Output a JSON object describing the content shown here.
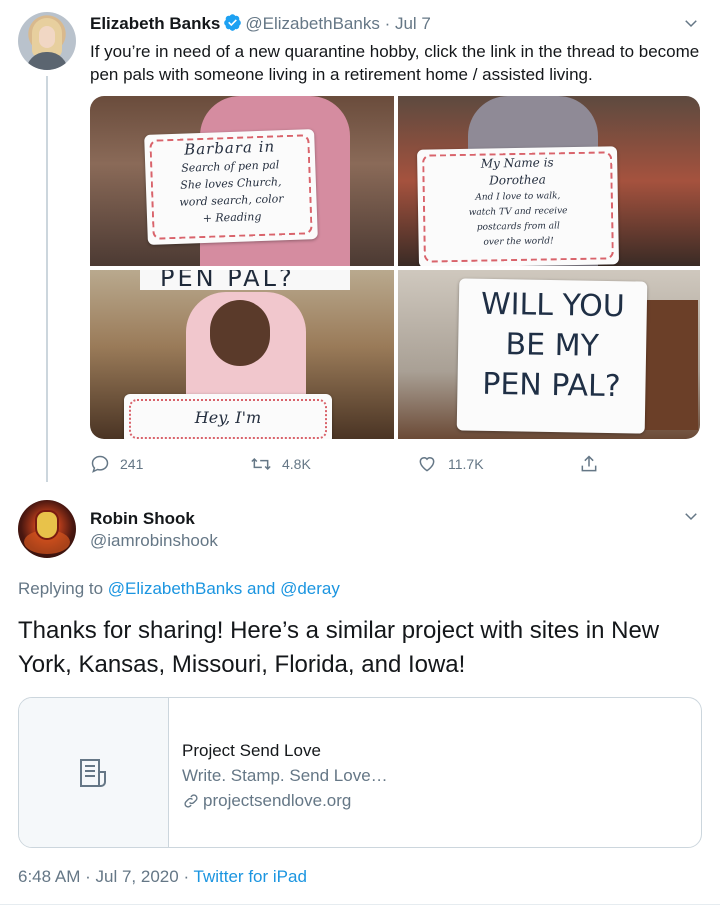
{
  "tweet1": {
    "name": "Elizabeth Banks",
    "handle": "@ElizabethBanks",
    "separator": "·",
    "date": "Jul 7",
    "text": "If you’re in need of a new quarantine hobby, click the link in the thread to become pen pals with someone living in a retirement home / assisted living.",
    "photos": {
      "sign1": [
        "Barbara in",
        "Search of pen pal",
        "She loves Church,",
        "word search, color",
        "+ Reading"
      ],
      "sign2": [
        "My Name is",
        "Dorothea",
        "And I love to walk,",
        "watch TV and receive",
        "postcards from all",
        "over the world!"
      ],
      "sign3_top": "PEN PAL?",
      "sign3": "Hey, I'm",
      "sign4": [
        "WILL YOU",
        "BE MY",
        "PEN PAL?"
      ]
    },
    "actions": {
      "replies": "241",
      "retweets": "4.8K",
      "likes": "11.7K"
    }
  },
  "tweet2": {
    "name": "Robin Shook",
    "handle": "@iamrobinshook",
    "replying_prefix": "Replying to",
    "replying_user1": "@ElizabethBanks",
    "replying_and": "and",
    "replying_user2": "@deray",
    "text": "Thanks for sharing! Here’s a similar project with sites in New York, Kansas, Missouri, Florida, and Iowa!",
    "card": {
      "title": "Project Send Love",
      "description": "Write. Stamp. Send Love…",
      "url": "projectsendlove.org"
    },
    "time": "6:48 AM",
    "separator": "·",
    "date": "Jul 7, 2020",
    "source": "Twitter for iPad"
  },
  "colors": {
    "link": "#1b95e0",
    "muted": "#657786",
    "border": "#ccd6dd"
  },
  "icons": [
    "verified-badge-icon",
    "chevron-down-icon",
    "reply-icon",
    "retweet-icon",
    "like-icon",
    "share-icon",
    "document-icon",
    "link-icon"
  ]
}
